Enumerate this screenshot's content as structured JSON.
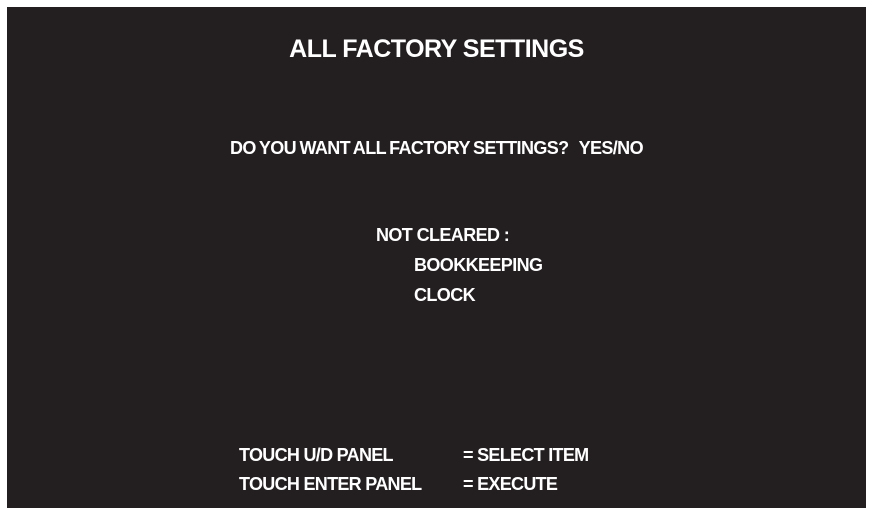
{
  "screen": {
    "title": "ALL FACTORY SETTINGS",
    "question": "DO YOU WANT ALL FACTORY SETTINGS?",
    "options": "YES/NO",
    "not_cleared": {
      "label": "NOT CLEARED :",
      "items": [
        "BOOKKEEPING",
        "CLOCK"
      ]
    },
    "controls": [
      {
        "key": "TOUCH U/D PANEL",
        "action": "= SELECT ITEM"
      },
      {
        "key": "TOUCH ENTER PANEL",
        "action": "= EXECUTE"
      }
    ],
    "colors": {
      "background": "#231f20",
      "text": "#ffffff",
      "frame": "#ffffff"
    }
  }
}
